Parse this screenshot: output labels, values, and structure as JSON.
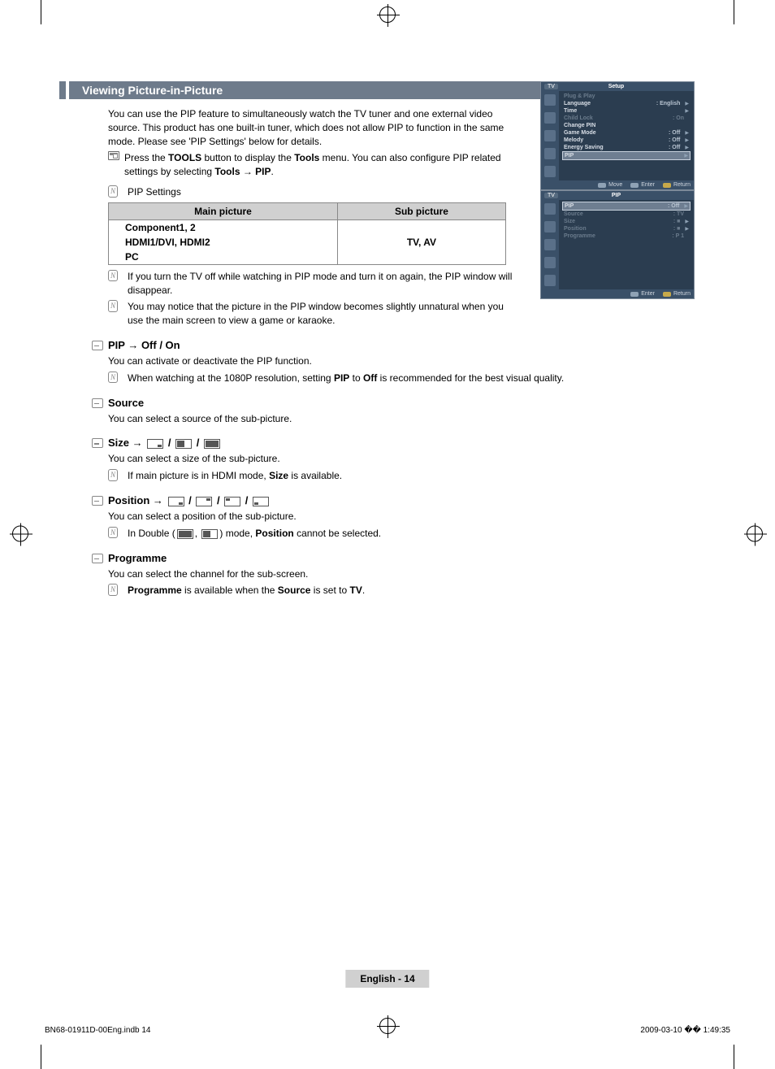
{
  "header": {
    "title": "Viewing Picture-in-Picture"
  },
  "intro": {
    "p1": "You can use the PIP feature to simultaneously watch the TV tuner and one external video source. This product has one built-in tuner, which does not allow PIP to function in the same mode. Please see 'PIP Settings' below for details.",
    "tools_pre": "Press the ",
    "tools_b1": "TOOLS",
    "tools_mid": " button to display the ",
    "tools_b2": "Tools",
    "tools_post": " menu. You can also configure PIP related settings by selecting ",
    "tools_b3": "Tools → PIP",
    "tools_end": "."
  },
  "pip_settings_label": "PIP Settings",
  "table": {
    "th1": "Main picture",
    "th2": "Sub picture",
    "r1": "Component1, 2",
    "r2": "HDMI1/DVI, HDMI2",
    "r3": "PC",
    "sub": "TV, AV"
  },
  "notes": {
    "n1": "If you turn the TV off while watching in PIP mode and turn it on again, the PIP window will disappear.",
    "n2": "You may notice that the picture in the PIP window becomes slightly unnatural when you use the main screen to view a game or karaoke."
  },
  "sections": {
    "pip_onoff": {
      "head": "PIP → Off / On",
      "body": "You can activate or deactivate the PIP function.",
      "note_pre": "When watching at the 1080P resolution, setting ",
      "note_b1": "PIP",
      "note_mid": " to ",
      "note_b2": "Off",
      "note_post": " is recommended for the best visual quality."
    },
    "source": {
      "head": "Source",
      "body": "You can select a source of the sub-picture."
    },
    "size": {
      "head": "Size → ",
      "body": "You can select a size of the sub-picture.",
      "note_pre": "If main picture is in HDMI mode, ",
      "note_b": "Size",
      "note_post": " is available."
    },
    "position": {
      "head": "Position → ",
      "body": "You can select a position of the sub-picture.",
      "note_pre": "In Double (",
      "note_mid": ", ",
      "note_post": ") mode, ",
      "note_b": "Position",
      "note_end": " cannot be selected."
    },
    "programme": {
      "head": "Programme",
      "body": "You can select the channel for the sub-screen.",
      "note_b1": "Programme",
      "note_mid": " is available when the ",
      "note_b2": "Source",
      "note_mid2": " is set to ",
      "note_b3": "TV",
      "note_end": "."
    }
  },
  "osd1": {
    "tv": "TV",
    "title": "Setup",
    "rows": [
      {
        "lbl": "Plug & Play",
        "val": "",
        "dim": true
      },
      {
        "lbl": "Language",
        "val": ": English",
        "dim": false,
        "arr": true
      },
      {
        "lbl": "Time",
        "val": "",
        "dim": false,
        "arr": true
      },
      {
        "lbl": "Child Lock",
        "val": ": On",
        "dim": true,
        "arr": false
      },
      {
        "lbl": "Change PIN",
        "val": "",
        "dim": false,
        "arr": false
      },
      {
        "lbl": "Game Mode",
        "val": ": Off",
        "dim": false,
        "arr": true
      },
      {
        "lbl": "Melody",
        "val": ": Off",
        "dim": false,
        "arr": true
      },
      {
        "lbl": "Energy Saving",
        "val": ": Off",
        "dim": false,
        "arr": true
      },
      {
        "lbl": "PIP",
        "val": "",
        "sel": true,
        "arr": true
      }
    ],
    "footer": {
      "move": "Move",
      "enter": "Enter",
      "return": "Return"
    }
  },
  "osd2": {
    "tv": "TV",
    "title": "PIP",
    "rows": [
      {
        "lbl": "PIP",
        "val": ": Off",
        "sel": true,
        "arr": true
      },
      {
        "lbl": "Source",
        "val": ": TV",
        "dim": true,
        "arr": false
      },
      {
        "lbl": "Size",
        "val": ": ■",
        "dim": true,
        "arr": true
      },
      {
        "lbl": "Position",
        "val": ": ■",
        "dim": true,
        "arr": true
      },
      {
        "lbl": "Programme",
        "val": ": P 1",
        "dim": true,
        "arr": false
      }
    ],
    "footer": {
      "enter": "Enter",
      "return": "Return"
    }
  },
  "footer": {
    "page": "English - 14"
  },
  "printfooter": {
    "left": "BN68-01911D-00Eng.indb   14",
    "right": "2009-03-10   �� 1:49:35"
  }
}
